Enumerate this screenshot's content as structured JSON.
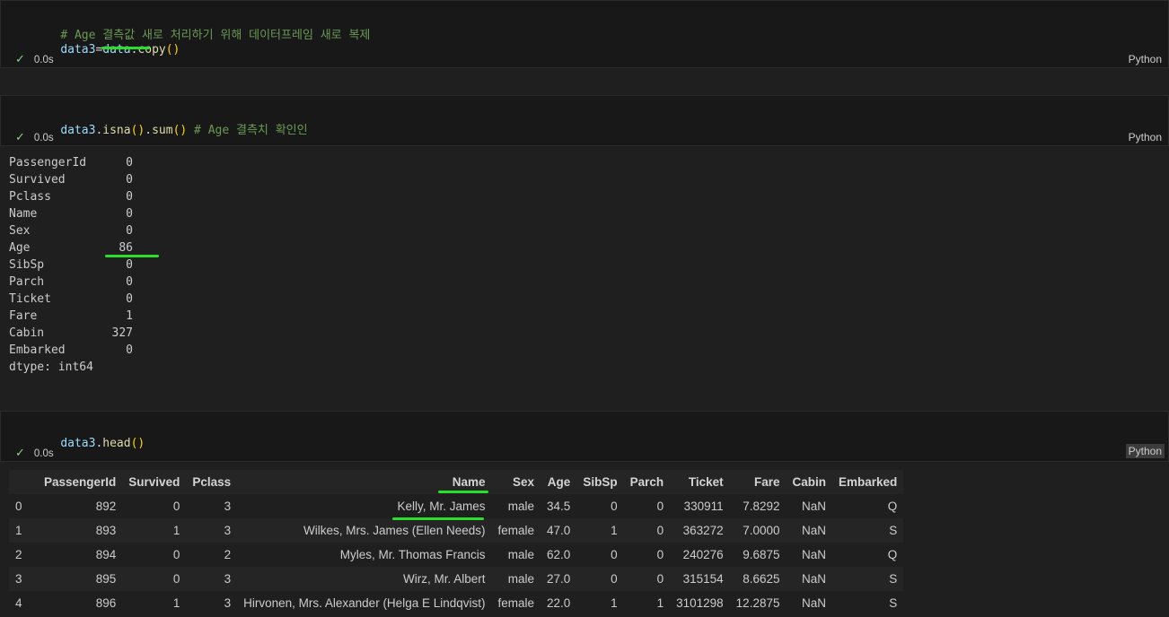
{
  "cells": [
    {
      "comment_line": "# Age 결측값 새로 처리하기 위해 데이터프레임 새로 복제",
      "code_var": "data3",
      "code_op": "=",
      "code_obj": "data",
      "code_dot": ".",
      "code_fn": "copy",
      "code_parens": "()",
      "status_check": "✓",
      "status_time": "0.0s",
      "language": "Python"
    },
    {
      "code_var": "data3",
      "code_dot1": ".",
      "code_fn1": "isna",
      "code_parens1": "()",
      "code_dot2": ".",
      "code_fn2": "sum",
      "code_parens2": "()",
      "comment": " # Age 결측치 확인인",
      "status_check": "✓",
      "status_time": "0.0s",
      "language": "Python"
    },
    {
      "code_var": "data3",
      "code_dot": ".",
      "code_fn": "head",
      "code_parens": "()",
      "status_check": "✓",
      "status_time": "0.0s",
      "language": "Python"
    }
  ],
  "series_output": {
    "rows": [
      {
        "name": "PassengerId",
        "value": "0"
      },
      {
        "name": "Survived",
        "value": "0"
      },
      {
        "name": "Pclass",
        "value": "0"
      },
      {
        "name": "Name",
        "value": "0"
      },
      {
        "name": "Sex",
        "value": "0"
      },
      {
        "name": "Age",
        "value": "86"
      },
      {
        "name": "SibSp",
        "value": "0"
      },
      {
        "name": "Parch",
        "value": "0"
      },
      {
        "name": "Ticket",
        "value": "0"
      },
      {
        "name": "Fare",
        "value": "1"
      },
      {
        "name": "Cabin",
        "value": "327"
      },
      {
        "name": "Embarked",
        "value": "0"
      }
    ],
    "dtype": "dtype: int64"
  },
  "dataframe": {
    "columns": [
      "",
      "PassengerId",
      "Survived",
      "Pclass",
      "Name",
      "Sex",
      "Age",
      "SibSp",
      "Parch",
      "Ticket",
      "Fare",
      "Cabin",
      "Embarked"
    ],
    "rows": [
      [
        "0",
        "892",
        "0",
        "3",
        "Kelly, Mr. James",
        "male",
        "34.5",
        "0",
        "0",
        "330911",
        "7.8292",
        "NaN",
        "Q"
      ],
      [
        "1",
        "893",
        "1",
        "3",
        "Wilkes, Mrs. James (Ellen Needs)",
        "female",
        "47.0",
        "1",
        "0",
        "363272",
        "7.0000",
        "NaN",
        "S"
      ],
      [
        "2",
        "894",
        "0",
        "2",
        "Myles, Mr. Thomas Francis",
        "male",
        "62.0",
        "0",
        "0",
        "240276",
        "9.6875",
        "NaN",
        "Q"
      ],
      [
        "3",
        "895",
        "0",
        "3",
        "Wirz, Mr. Albert",
        "male",
        "27.0",
        "0",
        "0",
        "315154",
        "8.6625",
        "NaN",
        "S"
      ],
      [
        "4",
        "896",
        "1",
        "3",
        "Hirvonen, Mrs. Alexander (Helga E Lindqvist)",
        "female",
        "22.0",
        "1",
        "1",
        "3101298",
        "12.2875",
        "NaN",
        "S"
      ]
    ]
  },
  "colors": {
    "background": "#1f1f1f",
    "cell_background": "#181818",
    "annotation_green": "#28e02a",
    "comment": "#6a9955",
    "variable": "#9cdcfe",
    "function": "#dcdcaa",
    "paren": "#ffd700"
  }
}
